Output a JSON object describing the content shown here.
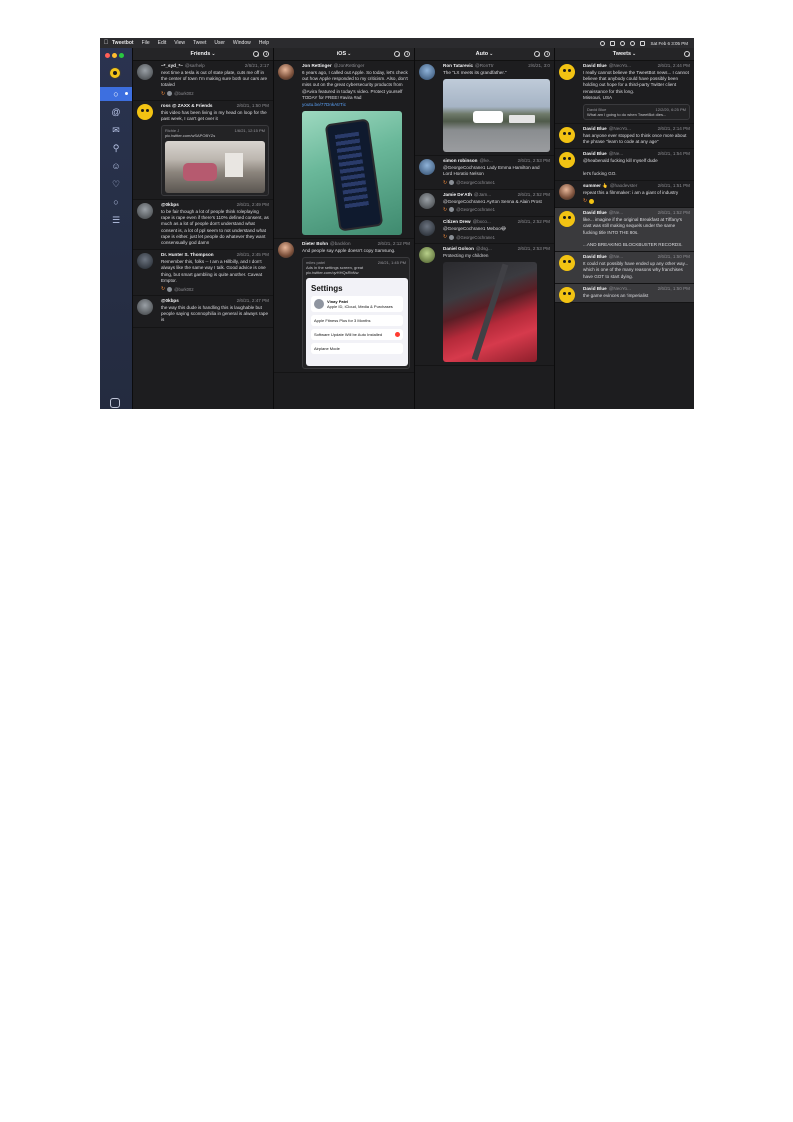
{
  "menubar": {
    "app_name": "Tweetbot",
    "items": [
      "File",
      "Edit",
      "View",
      "Tweet",
      "User",
      "Window",
      "Help"
    ],
    "clock": "Sat Feb 6  3:05 PM"
  },
  "colors": {
    "accent": "#3d6fe0",
    "sidebar": "#273048",
    "column_bg": "#1d1d1f",
    "link": "#5aa0f5",
    "retweet": "#f08a3a"
  },
  "sidebar": {
    "icons": [
      "timeline-icon",
      "mentions-icon",
      "messages-icon",
      "search-icon",
      "profile-icon",
      "likes-icon",
      "lists-icon",
      "more-icon",
      "compose-icon"
    ]
  },
  "columns": [
    {
      "title": "Friends",
      "tweets": [
        {
          "name": "~*_syd_*~",
          "handle": "@sarhelp",
          "date": "2/6/21, 2:17",
          "text": "next time a tesla is out of state plate, cuts me off in the center of town I'm making sure both our cars are totaled",
          "footer": "@burk002"
        },
        {
          "name": "ross @ ZAXX & Friends",
          "handle": "",
          "date": "2/6/21, 1:50 PM",
          "text": "this video has been living in my head on loop for the past week, I can't get over it",
          "quote_name": "Richie J",
          "quote_date": "1/6/21, 12:15 PM",
          "quote_text": "pic.twitter.com/wSAPOBYZs"
        },
        {
          "name": "@0kbps",
          "handle": "",
          "date": "2/6/21, 2:49 PM",
          "text": "to be fair though a lot of people think roleplaying rape is rape even if there's 110% defined consent, as much as a lot of people don't understand what consent is, a lot of ppl seem to not understand what rape is either. just let people do whatever they want consensually god damn"
        },
        {
          "name": "Dr. Hunter S. Thompson",
          "handle": "",
          "date": "2/6/21, 2:45 PM",
          "text": "Remember this, folks -- I am a Hillbilly, and I don't always like the same way I talk. Good advice is one thing, but smart gambling is quite another. Caveat Emptor.",
          "footer": "@burk002"
        },
        {
          "name": "@0kbps",
          "handle": "",
          "date": "2/6/21, 2:47 PM",
          "text": "the way this dude is handling this is laughable but people saying sconnophilia in general is always rape is"
        }
      ]
    },
    {
      "title": "iOS",
      "tweets": [
        {
          "name": "Jon Rettinger",
          "handle": "@JonRettinger",
          "date": "",
          "text": "6 years ago, I called out Apple. So today, let's check out how Apple responded to my criticism. Also, don't miss out on the great cybersecurity products from @Avira featured in today's video. Protect yourself TODAY for FREE! #avira #ad",
          "link": "youtu.be/77DnkAtrTic"
        },
        {
          "name": "Dieter Bohn",
          "handle": "@backlon",
          "date": "2/6/21, 2:12 PM",
          "text": "And people say Apple doesn't copy Samsung.",
          "quote_name": "miles patel",
          "quote_date": "2/6/21, 1:45 PM",
          "quote_text": "Ads in the settings screen, great pic.twitter.com/qvHHQsRbNw",
          "settings_title": "Settings",
          "settings_user": "Vinay Patel",
          "settings_sub": "Apple ID, iCloud, Media & Purchases",
          "settings_row1": "Apple Fitness Plus for 3 Months",
          "settings_row2": "Software Update Will be Auto Installed",
          "settings_row3": "Airplane Mode"
        }
      ]
    },
    {
      "title": "Auto",
      "tweets": [
        {
          "name": "Ron Tatarevic",
          "handle": "@RonTtr",
          "date": "2/6/21, 3:0",
          "text": "The \"LX meets its grandfather.\""
        },
        {
          "name": "simon robinson",
          "handle": "@ke...",
          "date": "2/6/21, 2:53 PM",
          "text": "@GeorgeCochrane1 Lady Emma Hamilton and Lord Horatio Nelson",
          "footer": "@GeorgeCochrane1"
        },
        {
          "name": "Jamie De'Ath",
          "handle": "@Jam...",
          "date": "2/6/21, 2:52 PM",
          "text": "@GeorgeCochrane1 Ayrton Senna & Alain Prost",
          "footer": "@GeorgeCochrane1"
        },
        {
          "name": "Citizen Drew",
          "handle": "@bxco...",
          "date": "2/6/21, 2:52 PM",
          "text": "@GeorgeCochrane1 Meboo😂",
          "footer": "@GeorgeCochrane1"
        },
        {
          "name": "Daniel Golson",
          "handle": "@dsg...",
          "date": "2/6/21, 2:53 PM",
          "text": "Protecting my children"
        }
      ]
    },
    {
      "title": "Tweets",
      "tweets": [
        {
          "name": "David Blue",
          "handle": "@NeoYo...",
          "date": "2/6/21, 2:44 PM",
          "text": "I really cannot believe the TweetBot news... I cannot believe that anybody could have possibly been holding out hope for a third-party Twitter client renaissance for this long.\nMissouri, USA",
          "quote_name": "David Blue",
          "quote_date": "12/2/20, 6:25 PM",
          "quote_text": "What am I going to do when TweetBot dies...",
          "hl": false
        },
        {
          "name": "David Blue",
          "handle": "@NeoYo...",
          "date": "2/6/21, 2:14 PM",
          "text": "has anyone ever stopped to think once more about the phrase \"learn to code at any age\"",
          "hl": false
        },
        {
          "name": "David Blue",
          "handle": "@Ne...",
          "date": "2/6/21, 1:54 PM",
          "text": "@heabenald fucking kill myself dude\n\nlet's fucking GO.",
          "hl": false
        },
        {
          "name": "summer 👆",
          "handle": "@haodevster",
          "date": "2/6/21, 1:51 PM",
          "text": "repeat this a filmmaker: i am a giant of industry",
          "hl": false
        },
        {
          "name": "David Blue",
          "handle": "@Ne...",
          "date": "2/6/21, 1:52 PM",
          "text": "like... imagine if the original Breakfast at Tiffany's cast was still making sequels under the same fucking title INTO THE 80s.\n\n...AND BREAKING BLOCKBUSTER RECORDS.",
          "hl": true
        },
        {
          "name": "David Blue",
          "handle": "@Ne...",
          "date": "2/6/21, 1:50 PM",
          "text": "It could not possibly have ended up any other way... which is one of the many reasons why franchises have GOT to start dying.",
          "hl": true
        },
        {
          "name": "David Blue",
          "handle": "@NeoYo...",
          "date": "2/6/21, 1:50 PM",
          "text": "the game evinces an 'imperialist",
          "hl": true
        }
      ]
    }
  ]
}
